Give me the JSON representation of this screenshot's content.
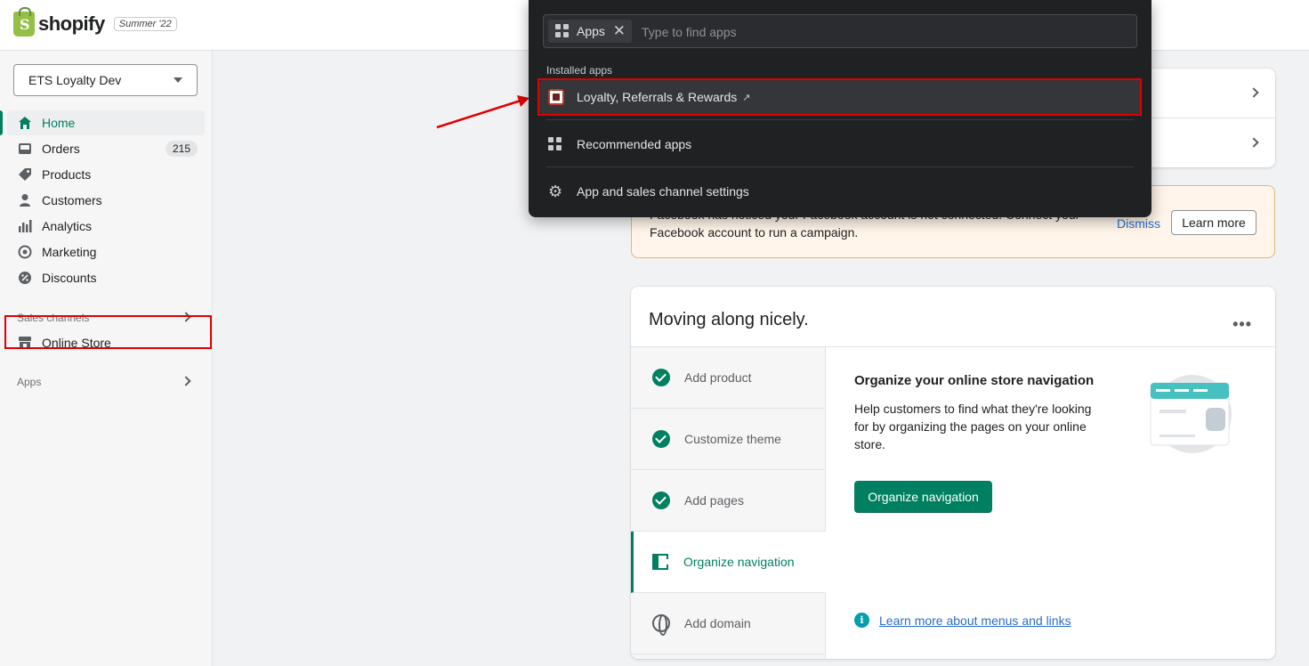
{
  "brand": {
    "name": "shopify",
    "edition_badge": "Summer '22"
  },
  "sidebar": {
    "store_name": "ETS Loyalty Dev",
    "items": [
      {
        "label": "Home",
        "icon": "home-icon",
        "active": true
      },
      {
        "label": "Orders",
        "icon": "inbox-icon",
        "badge": "215"
      },
      {
        "label": "Products",
        "icon": "tag-icon"
      },
      {
        "label": "Customers",
        "icon": "person-icon"
      },
      {
        "label": "Analytics",
        "icon": "bar-chart-icon"
      },
      {
        "label": "Marketing",
        "icon": "target-icon"
      },
      {
        "label": "Discounts",
        "icon": "discount-icon"
      }
    ],
    "sales_channels_label": "Sales channels",
    "online_store_label": "Online Store",
    "apps_label": "Apps"
  },
  "popover": {
    "tag_label": "Apps",
    "search_placeholder": "Type to find apps",
    "installed_label": "Installed apps",
    "installed_app": "Loyalty, Referrals & Rewards",
    "recommended_label": "Recommended apps",
    "settings_label": "App and sales channel settings"
  },
  "banner": {
    "text": "Facebook has noticed your Facebook account is not connected. Connect your Facebook account to run a campaign.",
    "dismiss": "Dismiss",
    "learn_more": "Learn more"
  },
  "setup": {
    "title": "Moving along nicely.",
    "steps": [
      {
        "label": "Add product",
        "done": true
      },
      {
        "label": "Customize theme",
        "done": true
      },
      {
        "label": "Add pages",
        "done": true
      },
      {
        "label": "Organize navigation",
        "current": true
      },
      {
        "label": "Add domain"
      }
    ],
    "detail_title": "Organize your online store navigation",
    "detail_body": "Help customers to find what they're looking for by organizing the pages on your online store.",
    "primary_button": "Organize navigation",
    "learn_link": "Learn more about menus and links"
  },
  "colors": {
    "accent": "#008060",
    "highlight": "#e00000",
    "link": "#2c6ecb",
    "popover_bg": "#202123"
  }
}
